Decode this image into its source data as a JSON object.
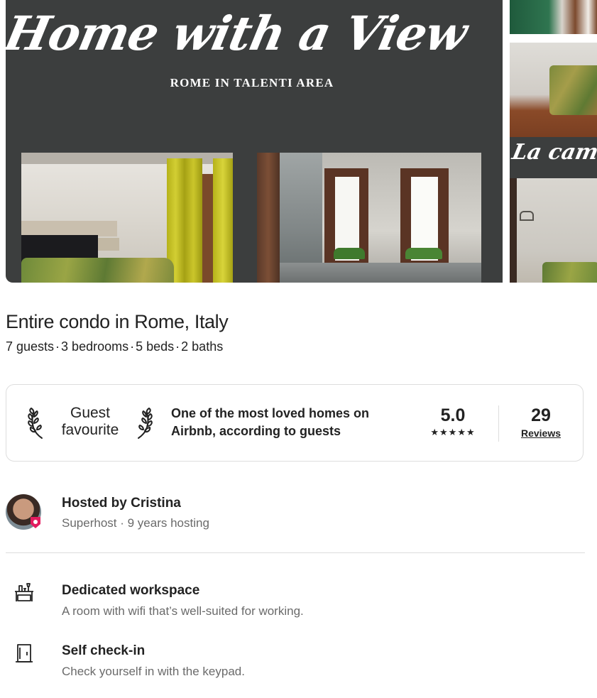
{
  "gallery": {
    "hero_title": "Home with a View",
    "hero_subtitle": "ROME IN TALENTI AREA",
    "thumb_caption": "La camera"
  },
  "listing": {
    "title": "Entire condo in Rome, Italy",
    "meta": [
      "7 guests",
      "3 bedrooms",
      "5 beds",
      "2 baths"
    ],
    "separator": "·"
  },
  "guest_favourite": {
    "label_line1": "Guest",
    "label_line2": "favourite",
    "description": "One of the most loved homes on Airbnb, according to guests",
    "rating": "5.0",
    "stars": "★★★★★",
    "reviews_count": "29",
    "reviews_label": "Reviews"
  },
  "host": {
    "name": "Hosted by Cristina",
    "subtitle": "Superhost · 9 years hosting",
    "badge_color": "#e31c5f"
  },
  "highlights": [
    {
      "icon": "workspace-desk-icon",
      "title": "Dedicated workspace",
      "description": "A room with wifi that’s well-suited for working."
    },
    {
      "icon": "door-keypad-icon",
      "title": "Self check-in",
      "description": "Check yourself in with the keypad."
    }
  ]
}
